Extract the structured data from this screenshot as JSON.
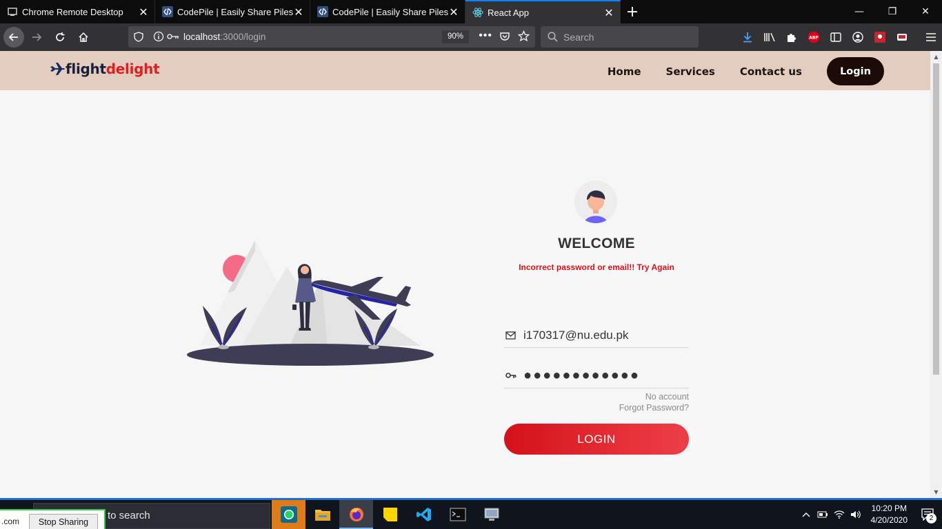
{
  "browser": {
    "tabs": [
      {
        "title": "Chrome Remote Desktop",
        "icon": "remote-desktop-icon"
      },
      {
        "title": "CodePile | Easily Share Piles of Code",
        "icon": "codepile-icon"
      },
      {
        "title": "CodePile | Easily Share Piles of Code",
        "icon": "codepile-icon"
      },
      {
        "title": "React App",
        "icon": "react-icon",
        "active": true
      }
    ],
    "url_host": "localhost",
    "url_path": ":3000/login",
    "zoom": "90%",
    "search_placeholder": "Search"
  },
  "site": {
    "logo_part1": "flight",
    "logo_part2": "delight",
    "nav": {
      "home": "Home",
      "services": "Services",
      "contact": "Contact us",
      "login": "Login"
    }
  },
  "login_form": {
    "heading": "WELCOME",
    "error": "Incorrect password or email!! Try Again",
    "email_value": "i170317@nu.edu.pk",
    "password_value": "●●●●●●●●●●●●",
    "no_account": "No account",
    "forgot_password": "Forgot Password?",
    "submit_label": "LOGIN"
  },
  "taskbar": {
    "search_text": "to search",
    "sharing_domain": ".com",
    "stop_sharing": "Stop Sharing",
    "time": "10:20 PM",
    "date": "4/20/2020",
    "notification_count": "2"
  },
  "colors": {
    "header_bg": "#e3cdbf",
    "brand_red": "#e11d24",
    "brand_navy": "#1b1f3b",
    "login_btn": "#1b0a06"
  }
}
